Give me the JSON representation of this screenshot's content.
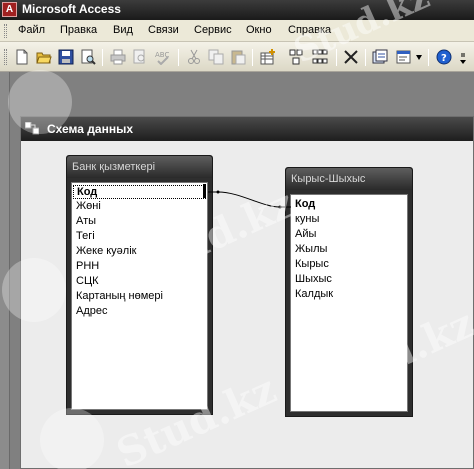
{
  "app": {
    "title": "Microsoft Access",
    "icon": "access-app-icon"
  },
  "menu": {
    "items": [
      "Файл",
      "Правка",
      "Вид",
      "Связи",
      "Сервис",
      "Окно",
      "Справка"
    ]
  },
  "toolbar": {
    "buttons": [
      "new-icon",
      "open-icon",
      "save-icon",
      "print-preview-icon",
      "print-icon",
      "preview-icon",
      "spelling-icon",
      "cut-icon",
      "copy-icon",
      "paste-icon",
      "show-table-icon",
      "show-direct-icon",
      "show-all-icon",
      "delete-icon",
      "new-object-icon",
      "properties-icon",
      "help-icon"
    ]
  },
  "window": {
    "title": "Схема данных",
    "icon": "relationships-window-icon"
  },
  "tables": [
    {
      "title": "Банк қызметкері",
      "fields": [
        "Код",
        "Жөні",
        "Аты",
        "Тегі",
        "Жеке куәлік",
        "РНН",
        "СЦК",
        "Картаның нөмері",
        "Адрес"
      ]
    },
    {
      "title": "Кырыс-Шыхыс",
      "fields": [
        "Код",
        "куны",
        "Айы",
        "Жылы",
        "Кырыс",
        "Шыхыс",
        "Калдык"
      ]
    }
  ],
  "watermark": {
    "text": "Stud.kz"
  }
}
